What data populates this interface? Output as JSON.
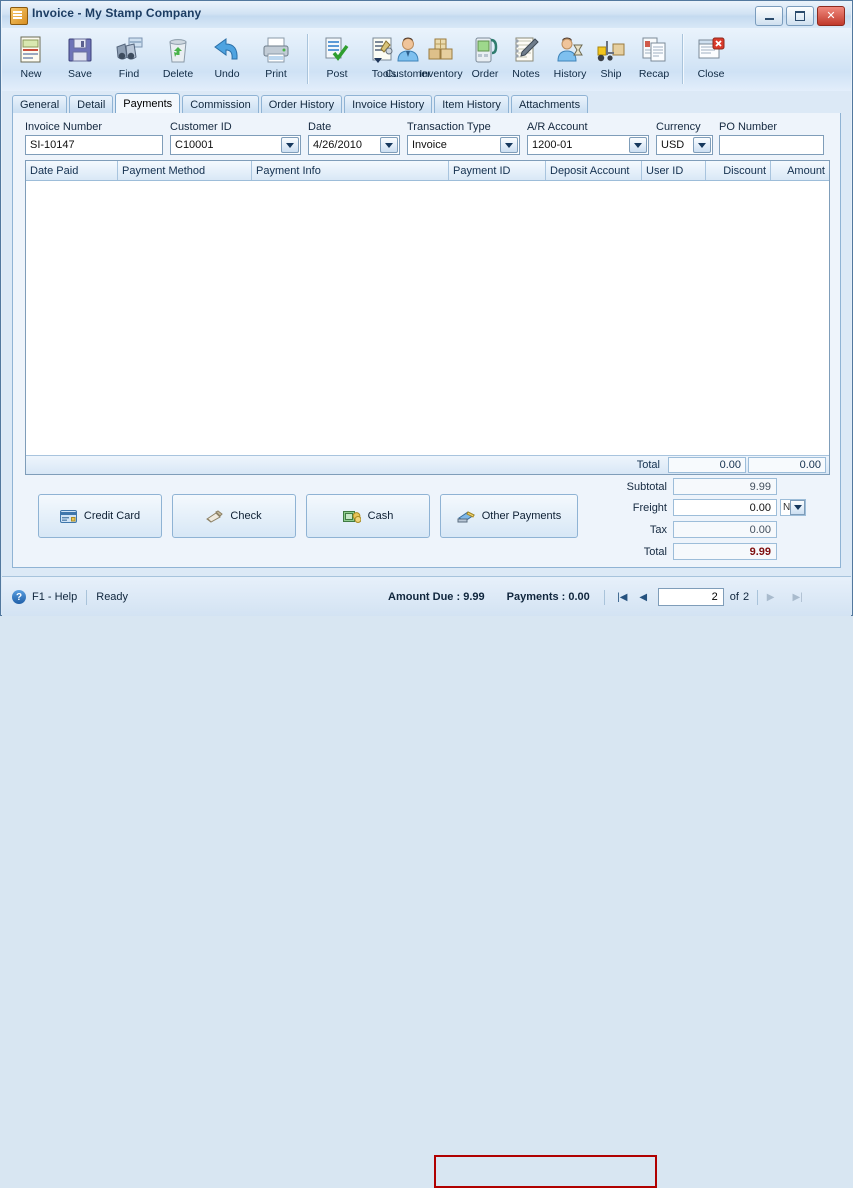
{
  "window": {
    "title": "Invoice - My Stamp Company",
    "minimize_label": "Minimize",
    "maximize_label": "Maximize",
    "close_label": "Close"
  },
  "toolbar": {
    "items": [
      {
        "label": "New",
        "icon": "new-document-icon"
      },
      {
        "label": "Save",
        "icon": "floppy-disk-icon"
      },
      {
        "label": "Find",
        "icon": "binoculars-icon"
      },
      {
        "label": "Delete",
        "icon": "recycle-bin-icon"
      },
      {
        "label": "Undo",
        "icon": "undo-arrow-icon"
      },
      {
        "label": "Print",
        "icon": "printer-icon"
      },
      {
        "label": "Post",
        "icon": "post-checkmark-icon"
      },
      {
        "label": "Tools",
        "icon": "tools-wrench-icon"
      },
      {
        "label": "Customer",
        "icon": "customer-person-icon"
      },
      {
        "label": "Inventory",
        "icon": "inventory-boxes-icon"
      },
      {
        "label": "Order",
        "icon": "order-device-icon"
      },
      {
        "label": "Notes",
        "icon": "notepad-pencil-icon"
      },
      {
        "label": "History",
        "icon": "history-hourglass-icon"
      },
      {
        "label": "Ship",
        "icon": "forklift-icon"
      },
      {
        "label": "Recap",
        "icon": "recap-report-icon"
      },
      {
        "label": "Close",
        "icon": "close-window-icon"
      }
    ]
  },
  "tabs": [
    {
      "label": "General",
      "active": false
    },
    {
      "label": "Detail",
      "active": false
    },
    {
      "label": "Payments",
      "active": true
    },
    {
      "label": "Commission",
      "active": false
    },
    {
      "label": "Order History",
      "active": false
    },
    {
      "label": "Invoice History",
      "active": false
    },
    {
      "label": "Item History",
      "active": false
    },
    {
      "label": "Attachments",
      "active": false
    }
  ],
  "form": {
    "invoice_number": {
      "label": "Invoice Number",
      "value": "SI-10147"
    },
    "customer_id": {
      "label": "Customer ID",
      "value": "C10001"
    },
    "date": {
      "label": "Date",
      "value": "4/26/2010"
    },
    "transaction_type": {
      "label": "Transaction Type",
      "value": "Invoice"
    },
    "ar_account": {
      "label": "A/R Account",
      "value": "1200-01"
    },
    "currency": {
      "label": "Currency",
      "value": "USD"
    },
    "po_number": {
      "label": "PO Number",
      "value": "",
      "placeholder": ""
    }
  },
  "grid": {
    "columns": [
      {
        "label": "Date Paid",
        "align": "left"
      },
      {
        "label": "Payment Method",
        "align": "left"
      },
      {
        "label": "Payment Info",
        "align": "left"
      },
      {
        "label": "Payment ID",
        "align": "left"
      },
      {
        "label": "Deposit Account",
        "align": "left"
      },
      {
        "label": "User ID",
        "align": "left"
      },
      {
        "label": "Discount",
        "align": "right"
      },
      {
        "label": "Amount",
        "align": "right"
      }
    ],
    "rows": [],
    "footer": {
      "label": "Total",
      "discount_total": "0.00",
      "amount_total": "0.00"
    }
  },
  "payment_buttons": [
    {
      "label": "Credit Card",
      "icon": "credit-card-icon"
    },
    {
      "label": "Check",
      "icon": "check-icon"
    },
    {
      "label": "Cash",
      "icon": "cash-icon"
    },
    {
      "label": "Other Payments",
      "icon": "other-payments-icon"
    }
  ],
  "totals": {
    "subtotal": {
      "label": "Subtotal",
      "value": "9.99"
    },
    "freight": {
      "label": "Freight",
      "value": "0.00",
      "tax_option": "N"
    },
    "tax": {
      "label": "Tax",
      "value": "0.00"
    },
    "total": {
      "label": "Total",
      "value": "9.99"
    }
  },
  "status_bar": {
    "help": "F1 - Help",
    "state": "Ready",
    "amount_due": "Amount Due : 9.99",
    "payments": "Payments : 0.00",
    "record_current": "2",
    "record_of": "of",
    "record_total": "2",
    "first_label": "First record",
    "prev_label": "Previous record",
    "next_label": "Next record",
    "last_label": "Last record"
  },
  "colors": {
    "accent": "#1c3d63",
    "highlight_box": "#b00000",
    "total_value": "#7f1010"
  }
}
